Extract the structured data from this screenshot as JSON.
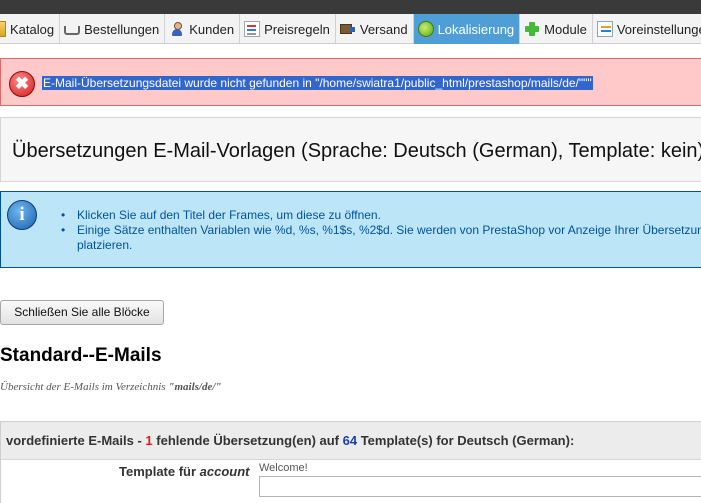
{
  "nav": {
    "tabs": [
      {
        "label": "Katalog",
        "icon": "folder-icon"
      },
      {
        "label": "Bestellungen",
        "icon": "cart-icon"
      },
      {
        "label": "Kunden",
        "icon": "user-icon"
      },
      {
        "label": "Preisregeln",
        "icon": "price-rules-icon"
      },
      {
        "label": "Versand",
        "icon": "truck-icon"
      },
      {
        "label": "Lokalisierung",
        "icon": "globe-icon",
        "active": true
      },
      {
        "label": "Module",
        "icon": "puzzle-plus-icon"
      },
      {
        "label": "Voreinstellungen",
        "icon": "preferences-icon"
      }
    ]
  },
  "error": {
    "message": "E-Mail-Übersetzungsdatei wurde nicht gefunden in \"/home/swiatra1/public_html/prestashop/mails/de/\"\"\"",
    "icon_glyph": "✖"
  },
  "page": {
    "title": "Übersetzungen E-Mail-Vorlagen (Sprache: Deutsch (German), Template: kein)"
  },
  "info": {
    "icon_glyph": "i",
    "items": [
      "Klicken Sie auf den Titel der Frames, um diese zu öffnen.",
      "Einige Sätze enthalten Variablen wie %d, %s, %1$s, %2$d. Sie werden von PrestaShop vor Anzeige Ihrer Übersetzung ersetzt."
    ],
    "item2_wrap": "platzieren."
  },
  "actions": {
    "close_all_label": "Schließen Sie alle Blöcke"
  },
  "section": {
    "heading": "Standard--E-Mails",
    "overview_prefix": "Übersicht der E-Mails im Verzeichnis ",
    "overview_path": "\"mails/de/\""
  },
  "mail_panel": {
    "header_prefix": "vordefinierte E-Mails - ",
    "missing_count": "1",
    "header_middle": " fehlende Übersetzung(en) auf ",
    "template_count": "64",
    "header_suffix": " Template(s) for Deutsch (German):",
    "template_label_prefix": "Template für ",
    "template_name": "account",
    "template_subject": "Welcome!",
    "input_value": ""
  },
  "colors": {
    "active_tab": "#4f9fd6",
    "error_bg": "#ffc9c9",
    "info_bg": "#bde5f8",
    "info_text": "#00529b",
    "missing": "#e01b1b",
    "total": "#1a3fa8"
  }
}
